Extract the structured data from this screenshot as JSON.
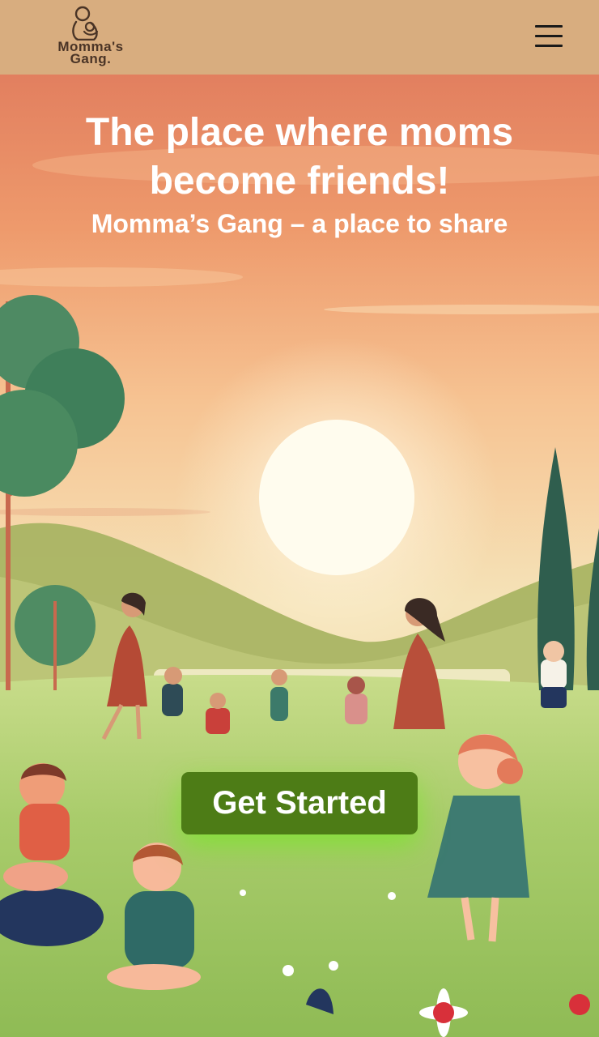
{
  "header": {
    "logo": {
      "line1": "Momma's",
      "line2": "Gang."
    },
    "menu_icon": "hamburger-menu-icon"
  },
  "hero": {
    "title": "The place where moms become friends!",
    "subtitle": "Momma’s Gang – a place to  share",
    "cta_label": "Get Started",
    "illustration": "moms-and-children-playing-in-meadow-at-sunset"
  },
  "colors": {
    "header_bg": "#d8ad7f",
    "cta_bg": "#4d7c16",
    "cta_glow": "#7ee02a",
    "text": "#ffffff"
  }
}
